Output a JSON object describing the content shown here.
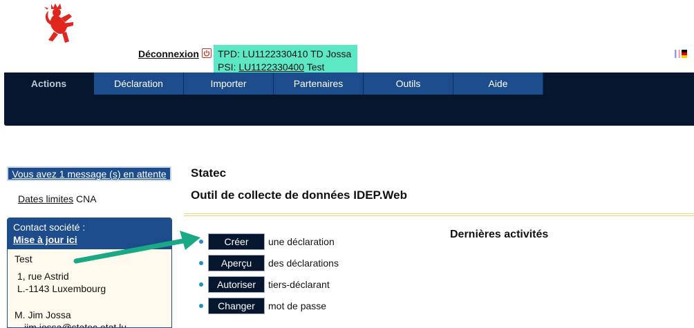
{
  "header": {
    "logout_label": "Déconnexion",
    "logout_icon": "power-icon",
    "tpd_line": "TPD: LU1122330410 TD Jossa",
    "psi_prefix": "PSI: ",
    "psi_id": "LU1122330400",
    "psi_suffix": " Test",
    "flags": [
      "fr-flag",
      "de-flag"
    ]
  },
  "nav": {
    "tabs": [
      {
        "label": "Actions",
        "active": true
      },
      {
        "label": "Déclaration"
      },
      {
        "label": "Importer"
      },
      {
        "label": "Partenaires"
      },
      {
        "label": "Outils"
      },
      {
        "label": "Aide"
      }
    ]
  },
  "sidebar": {
    "messages": "Vous avez 1 message (s) en attente",
    "dates_link": "Dates limites",
    "dates_suffix": " CNA",
    "contact_title": "Contact société :",
    "contact_update": "Mise à jour ici",
    "company": "Test",
    "address1": "1, rue Astrid",
    "address2": "L.-1143 Luxembourg",
    "person": "M. Jim Jossa",
    "email": "jim.jossa@statec.etat.lu"
  },
  "main": {
    "title": "Statec",
    "subtitle": "Outil de collecte de données IDEP.Web",
    "actions": [
      {
        "button": "Créer",
        "text": "une déclaration"
      },
      {
        "button": "Aperçu",
        "text": "des déclarations"
      },
      {
        "button": "Autoriser",
        "text": "tiers-déclarant"
      },
      {
        "button": "Changer",
        "text": "mot de passe"
      }
    ],
    "recent_title": "Dernières activités"
  },
  "colors": {
    "nav_dark": "#05162e",
    "nav_blue": "#1c4c8c",
    "highlight": "#5ce8c4",
    "arrow": "#1aa885",
    "logo_red": "#e0271f"
  }
}
